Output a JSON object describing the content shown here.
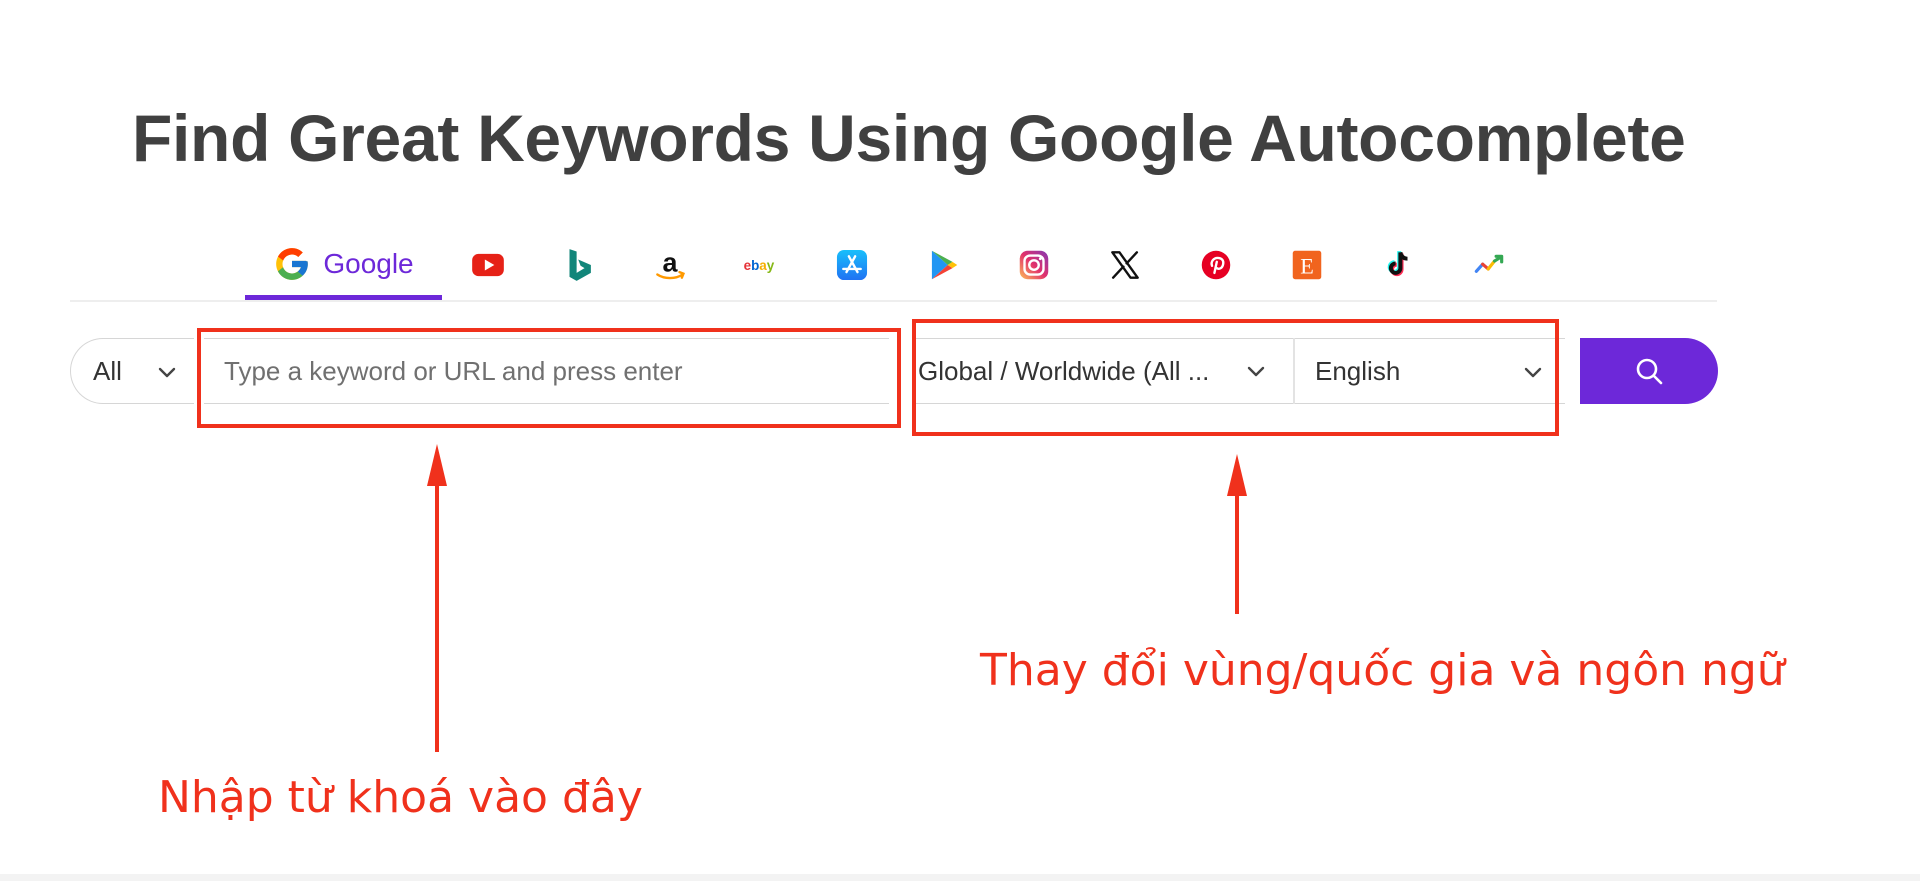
{
  "page": {
    "title": "Find Great Keywords Using Google Autocomplete"
  },
  "tabs": [
    {
      "name": "Google",
      "label": "Google",
      "icon": "google-icon",
      "active": true
    },
    {
      "name": "YouTube",
      "icon": "youtube-icon"
    },
    {
      "name": "Bing",
      "icon": "bing-icon"
    },
    {
      "name": "Amazon",
      "icon": "amazon-icon"
    },
    {
      "name": "eBay",
      "icon": "ebay-icon",
      "icon_text": "ebay"
    },
    {
      "name": "App Store",
      "icon": "app-store-icon"
    },
    {
      "name": "Play Store",
      "icon": "play-store-icon"
    },
    {
      "name": "Instagram",
      "icon": "instagram-icon"
    },
    {
      "name": "X",
      "icon": "x-icon"
    },
    {
      "name": "Pinterest",
      "icon": "pinterest-icon"
    },
    {
      "name": "Etsy",
      "icon": "etsy-icon",
      "icon_text": "E"
    },
    {
      "name": "TikTok",
      "icon": "tiktok-icon"
    },
    {
      "name": "Trends",
      "icon": "trends-icon"
    }
  ],
  "search": {
    "filter_value": "All",
    "keyword_placeholder": "Type a keyword or URL and press enter",
    "keyword_value": "",
    "region_value": "Global / Worldwide (All ...",
    "language_value": "English",
    "search_icon": "search-icon"
  },
  "annotations": {
    "keyword_note": "Nhập từ khoá vào đây",
    "locale_note": "Thay đổi vùng/quốc gia và ngôn ngữ"
  },
  "colors": {
    "accent": "#6d28d9",
    "annotation": "#f0311c",
    "title": "#404040"
  }
}
